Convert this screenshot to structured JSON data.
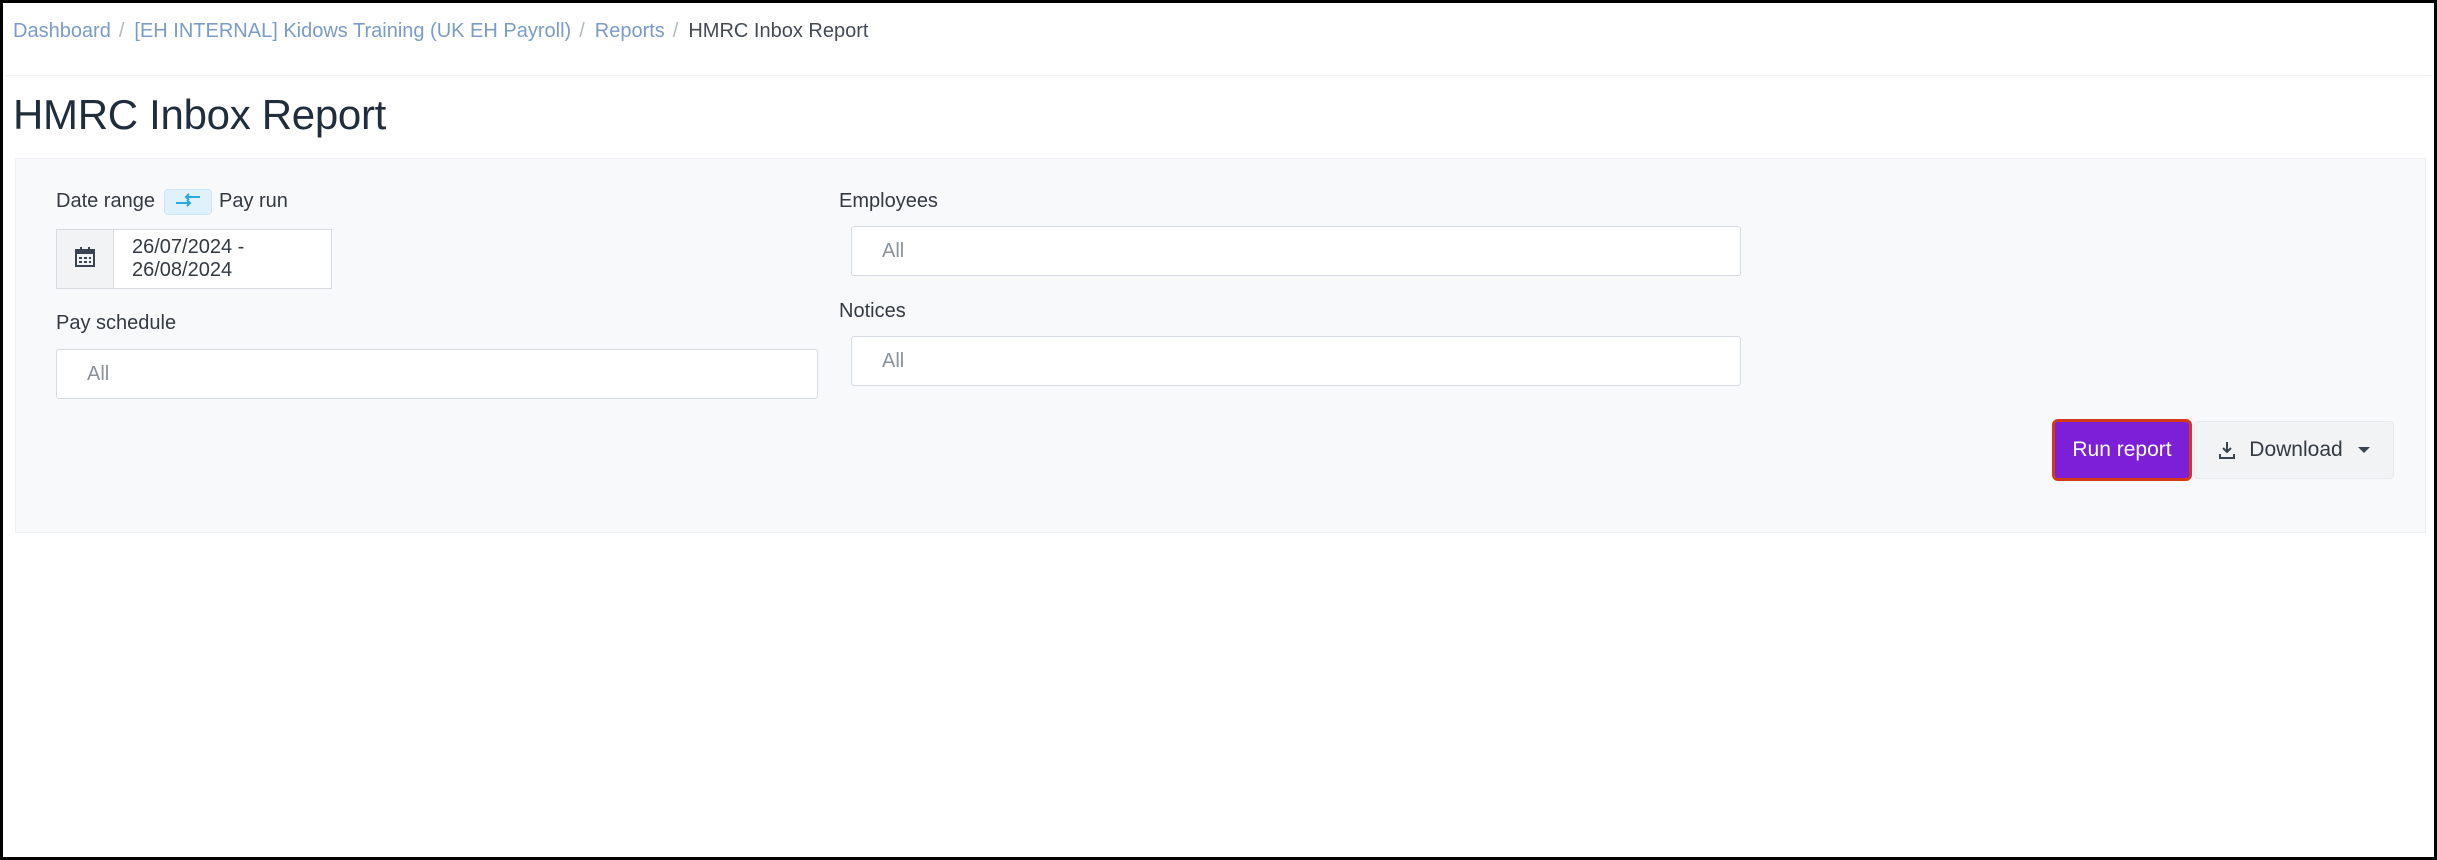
{
  "breadcrumb": {
    "items": [
      "Dashboard",
      "[EH INTERNAL] Kidows Training (UK EH Payroll)",
      "Reports"
    ],
    "separator": "/",
    "current": "HMRC Inbox Report"
  },
  "page": {
    "title": "HMRC Inbox Report"
  },
  "filters": {
    "date_range_label": "Date range",
    "pay_run_label": "Pay run",
    "date_value": "26/07/2024 - 26/08/2024",
    "pay_schedule_label": "Pay schedule",
    "pay_schedule_placeholder": "All",
    "employees_label": "Employees",
    "employees_placeholder": "All",
    "notices_label": "Notices",
    "notices_placeholder": "All"
  },
  "actions": {
    "run_report": "Run report",
    "download": "Download"
  },
  "icons": {
    "toggle": "swap-arrows-icon",
    "calendar": "calendar-icon",
    "download": "download-icon",
    "caret": "caret-down-icon"
  },
  "colors": {
    "accent": "#7c1fd6",
    "highlight_border": "#d23a1a",
    "link": "#7a9cc6",
    "toggle_arrows": "#2aa8e0"
  }
}
